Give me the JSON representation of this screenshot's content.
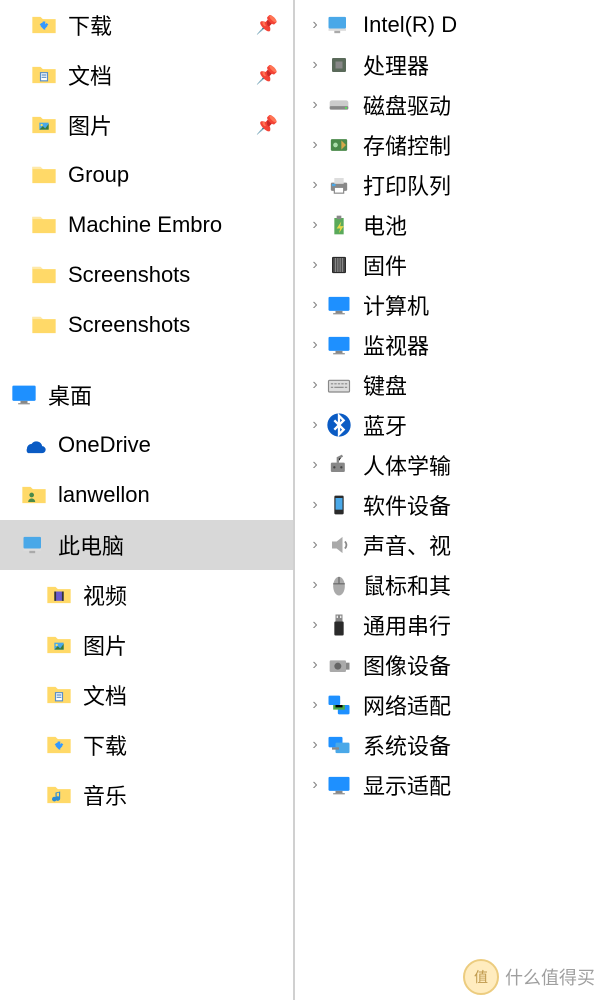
{
  "left_panel": {
    "quick_access": [
      {
        "label": "下载",
        "icon": "folder-download",
        "pinned": true
      },
      {
        "label": "文档",
        "icon": "folder-document",
        "pinned": true
      },
      {
        "label": "图片",
        "icon": "folder-picture",
        "pinned": true
      },
      {
        "label": "Group",
        "icon": "folder",
        "pinned": false
      },
      {
        "label": "Machine Embro",
        "icon": "folder",
        "pinned": false
      },
      {
        "label": "Screenshots",
        "icon": "folder",
        "pinned": false
      },
      {
        "label": "Screenshots",
        "icon": "folder",
        "pinned": false
      }
    ],
    "desktop_root": {
      "label": "桌面",
      "icon": "desktop"
    },
    "desktop_children": [
      {
        "label": "OneDrive",
        "icon": "onedrive"
      },
      {
        "label": "lanwellon",
        "icon": "user-folder"
      },
      {
        "label": "此电脑",
        "icon": "computer",
        "selected": true
      }
    ],
    "this_pc_children": [
      {
        "label": "视频",
        "icon": "folder-video"
      },
      {
        "label": "图片",
        "icon": "folder-picture"
      },
      {
        "label": "文档",
        "icon": "folder-document"
      },
      {
        "label": "下载",
        "icon": "folder-download"
      },
      {
        "label": "音乐",
        "icon": "folder-music"
      }
    ]
  },
  "right_panel": {
    "devices": [
      {
        "label": "Intel(R) D",
        "icon": "computer-icon"
      },
      {
        "label": "处理器",
        "icon": "cpu-icon"
      },
      {
        "label": "磁盘驱动",
        "icon": "disk-icon"
      },
      {
        "label": "存储控制",
        "icon": "storage-controller-icon"
      },
      {
        "label": "打印队列",
        "icon": "printer-icon"
      },
      {
        "label": "电池",
        "icon": "battery-icon"
      },
      {
        "label": "固件",
        "icon": "firmware-icon"
      },
      {
        "label": "计算机",
        "icon": "monitor-icon"
      },
      {
        "label": "监视器",
        "icon": "display-icon"
      },
      {
        "label": "键盘",
        "icon": "keyboard-icon"
      },
      {
        "label": "蓝牙",
        "icon": "bluetooth-icon"
      },
      {
        "label": "人体学输",
        "icon": "hid-icon"
      },
      {
        "label": "软件设备",
        "icon": "software-device-icon"
      },
      {
        "label": "声音、视",
        "icon": "sound-icon"
      },
      {
        "label": "鼠标和其",
        "icon": "mouse-icon"
      },
      {
        "label": "通用串行",
        "icon": "usb-icon"
      },
      {
        "label": "图像设备",
        "icon": "camera-icon"
      },
      {
        "label": "网络适配",
        "icon": "network-icon"
      },
      {
        "label": "系统设备",
        "icon": "system-device-icon"
      },
      {
        "label": "显示适配",
        "icon": "display-adapter-icon"
      }
    ]
  },
  "watermark": {
    "badge": "值",
    "text": "什么值得买"
  }
}
